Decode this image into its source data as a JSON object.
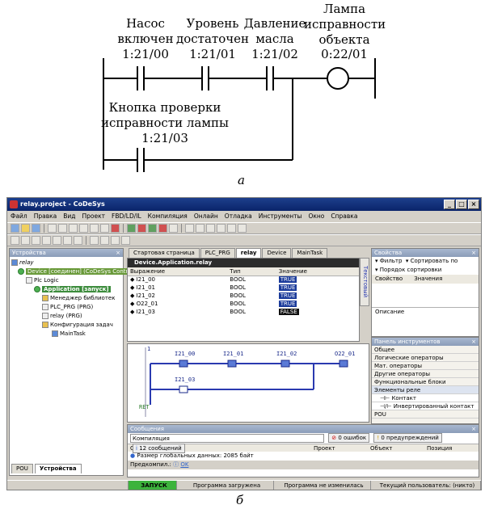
{
  "diagram": {
    "contacts": [
      {
        "name": "Насос\nвключен",
        "address": "1:21/00"
      },
      {
        "name": "Уровень\nдостаточен",
        "address": "1:21/01"
      },
      {
        "name": "Давление\nмасла",
        "address": "1:21/02"
      }
    ],
    "coil": {
      "name": "Лампа\nисправности\nобъекта",
      "address": "0:22/01"
    },
    "parallel": {
      "name": "Кнопка проверки\nисправности лампы",
      "address": "1:21/03"
    },
    "caption": "а"
  },
  "window": {
    "title": "relay.project - CoDeSys",
    "buttons": [
      "_",
      "□",
      "×"
    ],
    "menu": [
      "Файл",
      "Правка",
      "Вид",
      "Проект",
      "FBD/LD/IL",
      "Компиляция",
      "Онлайн",
      "Отладка",
      "Инструменты",
      "Окно",
      "Справка"
    ]
  },
  "devices": {
    "header": "Устройства",
    "tree": [
      "relay",
      "Device [соединен] (CoDeSys Contr",
      "Plc Logic",
      "Application [запуск]",
      "Менеджер библиотек",
      "PLC_PRG (PRG)",
      "relay (PRG)",
      "Конфигурация задач",
      "MainTask"
    ],
    "bottom_tabs": [
      "POU",
      "Устройства"
    ]
  },
  "editor": {
    "tabs": [
      "Стартовая страница",
      "PLC_PRG",
      "relay",
      "Device",
      "MainTask"
    ],
    "title": "Device.Application.relay",
    "columns": [
      "Выражение",
      "Тип",
      "Значение"
    ],
    "rows": [
      {
        "expr": "I21_00",
        "type": "BOOL",
        "value": "TRUE"
      },
      {
        "expr": "I21_01",
        "type": "BOOL",
        "value": "TRUE"
      },
      {
        "expr": "I21_02",
        "type": "BOOL",
        "value": "TRUE"
      },
      {
        "expr": "O22_01",
        "type": "BOOL",
        "value": "TRUE"
      },
      {
        "expr": "I21_03",
        "type": "BOOL",
        "value": "FALSE"
      }
    ],
    "side_tab": "Текстовый",
    "rung_number": "1",
    "ret": "RET",
    "ladder_labels": [
      "I21_00",
      "I21_01",
      "I21_02",
      "O22_01",
      "I21_03"
    ]
  },
  "properties": {
    "header": "Свойства",
    "filter": "Фильтр",
    "sort_by": "Сортировать по",
    "sort_order": "Порядок сортировки",
    "columns": [
      "Свойство",
      "Значения"
    ],
    "description": "Описание"
  },
  "toolbox": {
    "header": "Панель инструментов",
    "items": [
      "Общее",
      "Логические операторы",
      "Мат. операторы",
      "Другие операторы",
      "Функциональные блоки",
      "Элементы реле",
      "Контакт",
      "Инвертированный контакт",
      "POU"
    ]
  },
  "messages": {
    "header": "Сообщения",
    "category": "Компиляция",
    "errors": "0 ошибок",
    "warnings": "0 предупреждений",
    "messages": "12 сообщений",
    "columns": [
      "Описание",
      "Проект",
      "Объект",
      "Позиция"
    ],
    "row": "Размер глобальных данных: 2085 байт",
    "precompile": "Предкомпил.:",
    "ok": "OK"
  },
  "status": [
    "ЗАПУСК",
    "Программа загружена",
    "Программа не изменилась",
    "Текущий пользователь: (никто)"
  ],
  "figure_caption": "б",
  "colors": {
    "running": "#3cb33c",
    "title_bar": "#0a246a",
    "rung": "#2a3ab0"
  }
}
